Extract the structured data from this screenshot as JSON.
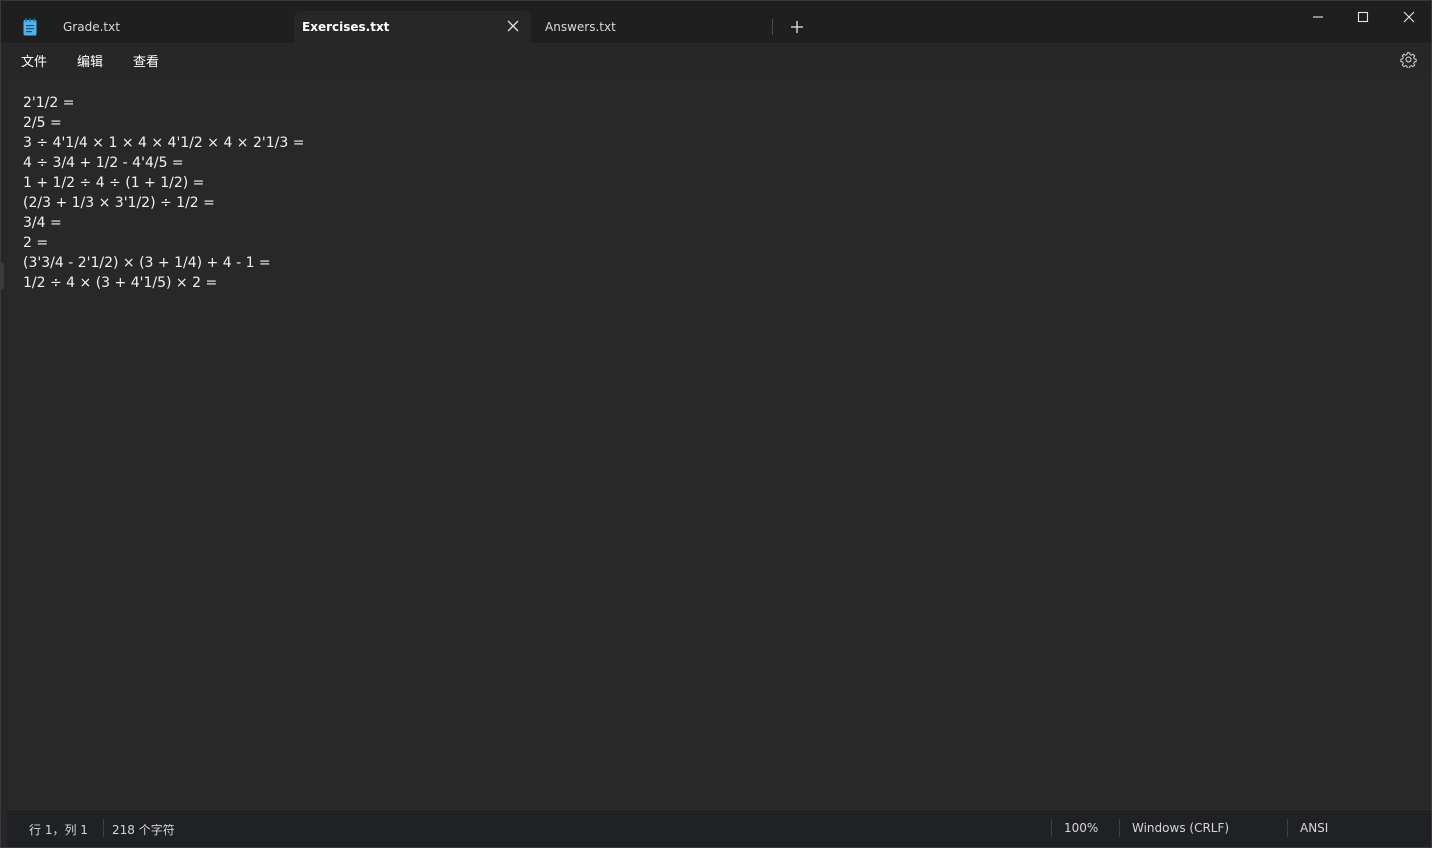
{
  "tabs": {
    "items": [
      {
        "label": "Grade.txt"
      },
      {
        "label": "Exercises.txt"
      },
      {
        "label": "Answers.txt"
      }
    ],
    "active_index": 1
  },
  "menu": {
    "file": "文件",
    "edit": "编辑",
    "view": "查看"
  },
  "editor": {
    "lines": [
      "2'1/2 =",
      "2/5 =",
      "3 ÷ 4'1/4 × 1 × 4 × 4'1/2 × 4 × 2'1/3 =",
      "4 ÷ 3/4 + 1/2 - 4'4/5 =",
      "1 + 1/2 ÷ 4 ÷ (1 + 1/2) =",
      "(2/3 + 1/3 × 3'1/2) ÷ 1/2 =",
      "3/4 =",
      "2 =",
      "(3'3/4 - 2'1/2) × (3 + 1/4) + 4 - 1 =",
      "1/2 ÷ 4 × (3 + 4'1/5) × 2 ="
    ]
  },
  "status": {
    "position": "行 1，列 1",
    "char_count": "218 个字符",
    "zoom": "100%",
    "line_ending": "Windows (CRLF)",
    "encoding": "ANSI"
  },
  "colors": {
    "titlebar": "#1f1f1f",
    "editor_bg": "#282828",
    "statusbar": "#1f2124",
    "text": "#f2f2f2",
    "app_icon": "#4fb3e8"
  },
  "icons": {
    "app": "notepad-icon",
    "close_tab": "close-icon",
    "new_tab": "plus-icon",
    "minimize": "minimize-icon",
    "maximize": "maximize-icon",
    "close_window": "close-window-icon",
    "settings": "gear-icon"
  }
}
